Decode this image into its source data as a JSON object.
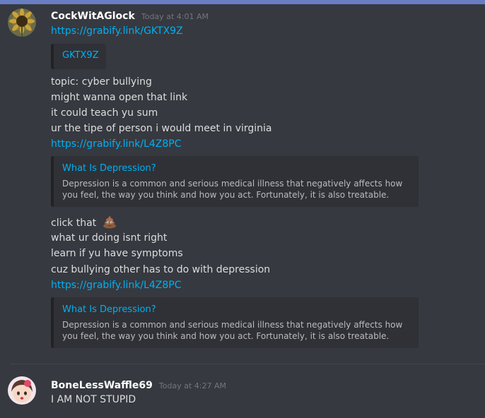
{
  "messages": [
    {
      "author": "CockWitAGlock",
      "timestamp": "Today at 4:01 AM",
      "avatar_icon": "sunflower-avatar",
      "lines": [
        "https://grabify.link/GKTX9Z",
        "topic: cyber bullying",
        "might wanna open that link",
        "it could teach yu sum",
        "ur the tipe of person i would meet in virginia",
        "https://grabify.link/L4Z8PC",
        "click that",
        "what ur doing isnt right",
        "learn if yu have symptoms",
        "cuz bullying other has to do with depression",
        "https://grabify.link/L4Z8PC"
      ],
      "embeds": [
        {
          "title": "GKTX9Z",
          "description": ""
        },
        {
          "title": "What Is Depression?",
          "description": "Depression is a common and serious medical illness that negatively affects how you feel, the way you think and how you act. Fortunately, it is also treatable."
        },
        {
          "title": "What Is Depression?",
          "description": "Depression is a common and serious medical illness that negatively affects how you feel, the way you think and how you act. Fortunately, it is also treatable."
        }
      ],
      "emoji": "poop-emoji"
    },
    {
      "author": "BoneLessWaffle69",
      "timestamp": "Today at 4:27 AM",
      "avatar_icon": "anime-avatar",
      "lines": [
        "I AM NOT STUPID"
      ]
    }
  ],
  "colors": {
    "background": "#36393f",
    "link": "#00b0f4",
    "embed_bg": "#2f3136",
    "username": "#ffffff",
    "timestamp": "#72767d"
  }
}
